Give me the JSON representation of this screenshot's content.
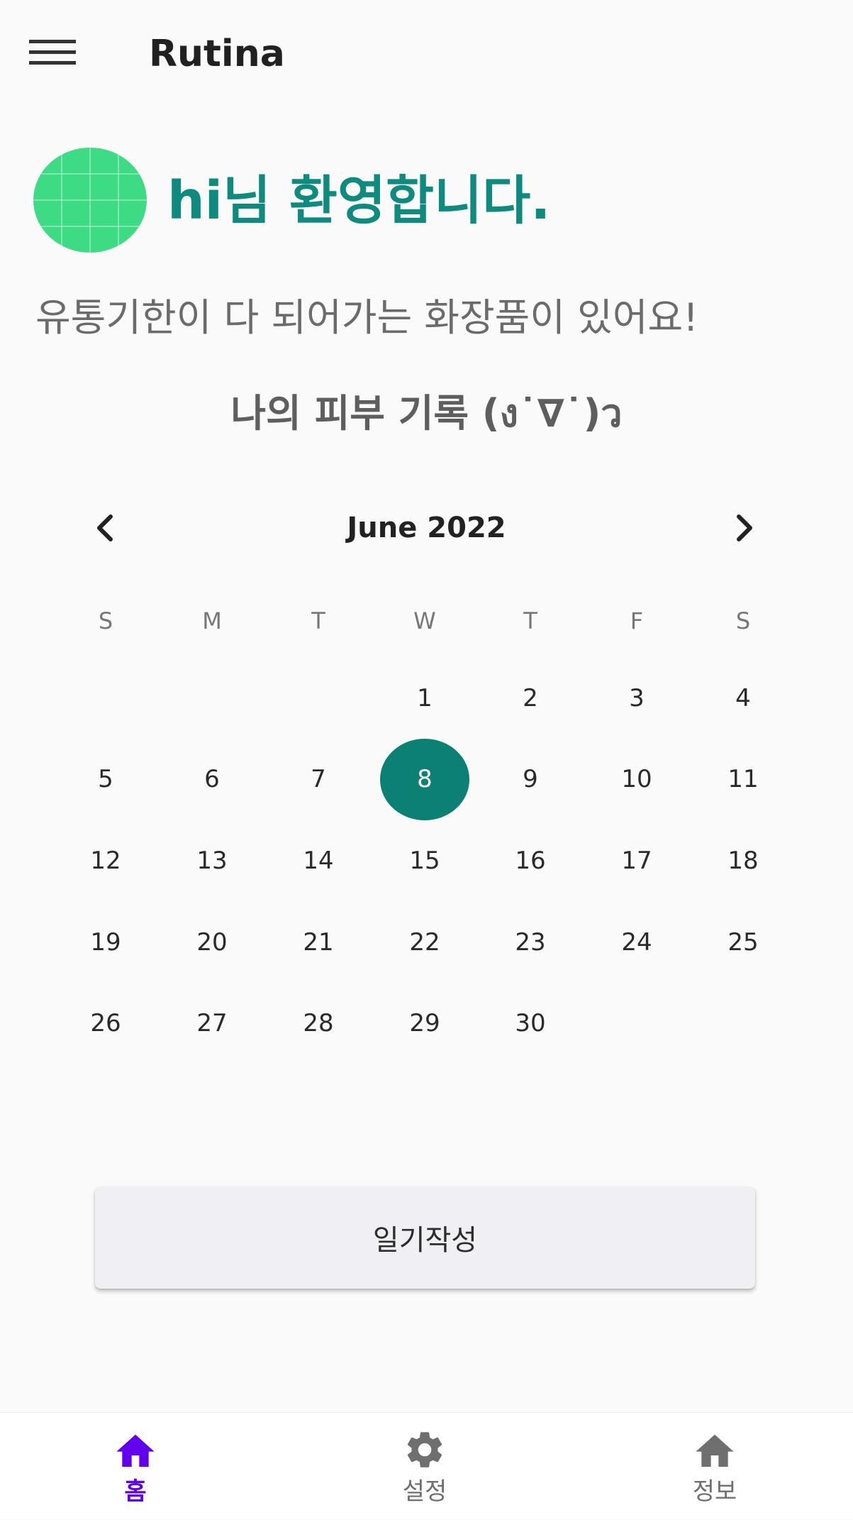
{
  "app_bar": {
    "title": "Rutina",
    "menu_icon": "hamburger-menu-icon"
  },
  "profile": {
    "avatar_color": "#3ddc84",
    "welcome": "hi님 환영합니다.",
    "welcome_color": "#0f8a7e"
  },
  "notice": "유통기한이 다 되어가는 화장품이 있어요!",
  "record_title": "나의 피부 기록 (ง˙∇˙)ว",
  "calendar": {
    "month_label": "June 2022",
    "prev_icon": "chevron-left-icon",
    "next_icon": "chevron-right-icon",
    "weekdays": [
      "S",
      "M",
      "T",
      "W",
      "T",
      "F",
      "S"
    ],
    "weeks": [
      [
        "",
        "",
        "",
        "1",
        "2",
        "3",
        "4"
      ],
      [
        "5",
        "6",
        "7",
        "8",
        "9",
        "10",
        "11"
      ],
      [
        "12",
        "13",
        "14",
        "15",
        "16",
        "17",
        "18"
      ],
      [
        "19",
        "20",
        "21",
        "22",
        "23",
        "24",
        "25"
      ],
      [
        "26",
        "27",
        "28",
        "29",
        "30",
        "",
        ""
      ]
    ],
    "selected_day": "8",
    "selected_color": "#0b8073"
  },
  "diary_button": {
    "label": "일기작성"
  },
  "bottom_nav": {
    "active_color": "#6200ee",
    "items": [
      {
        "label": "홈",
        "icon": "home-icon",
        "active": true
      },
      {
        "label": "설정",
        "icon": "gear-icon",
        "active": false
      },
      {
        "label": "정보",
        "icon": "home-icon",
        "active": false
      }
    ]
  }
}
